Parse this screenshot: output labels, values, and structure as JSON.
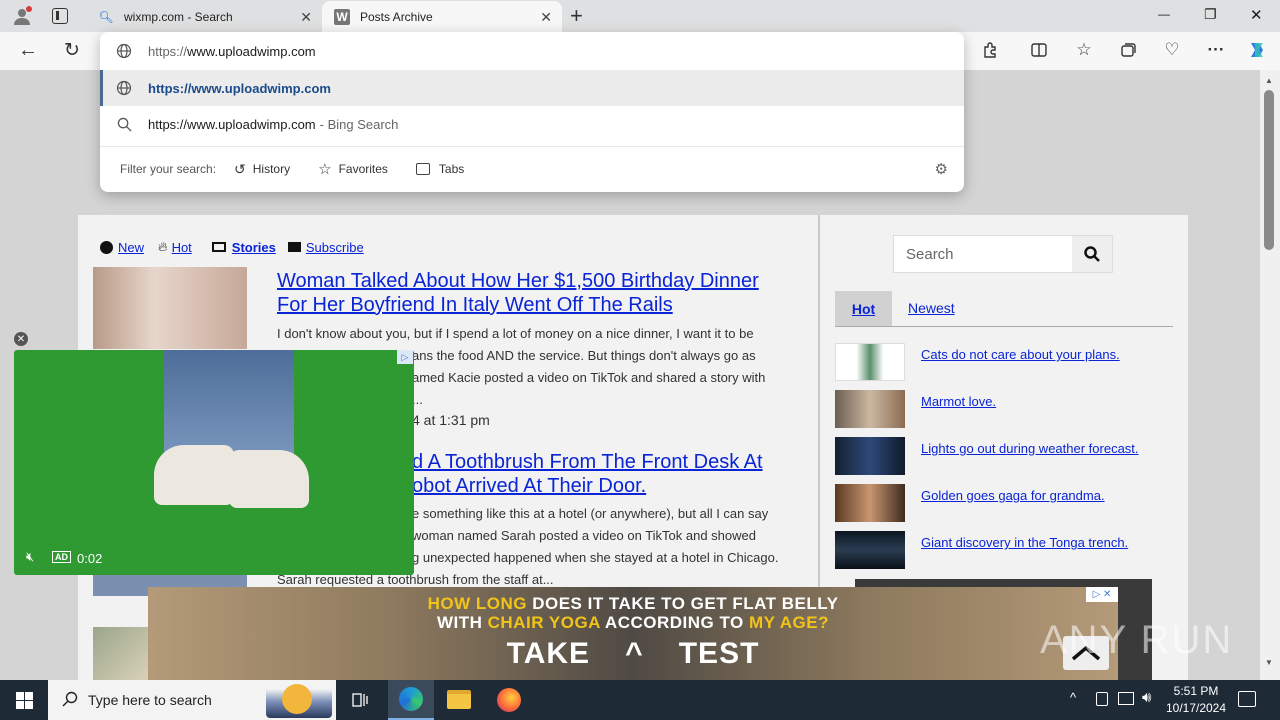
{
  "browser": {
    "tabs": [
      {
        "title": "wixmp.com - Search",
        "favicon": "search-icon",
        "active": false
      },
      {
        "title": "Posts Archive",
        "favicon": "W",
        "active": true
      }
    ],
    "new_tab": "+",
    "window_controls": {
      "minimize": "—",
      "maximize": "❐",
      "close": "✕"
    }
  },
  "omnibox": {
    "input_prefix": "https://",
    "input_value": "www.uploadwimp.com",
    "suggestions": [
      {
        "text": "https://www.uploadwimp.com",
        "icon": "globe-icon",
        "selected": true
      },
      {
        "text": "https://www.uploadwimp.com",
        "suffix": "- Bing Search",
        "icon": "search-icon",
        "selected": false
      }
    ],
    "filter_label": "Filter your search:",
    "filters": [
      "History",
      "Favorites",
      "Tabs"
    ]
  },
  "site": {
    "nav": [
      "New",
      "Hot",
      "Stories",
      "Subscribe"
    ],
    "posts": [
      {
        "title_line1": "Woman Talked About How Her $1,500 Birthday Dinner",
        "title_line2": "For Her Boyfriend In Italy Went Off The Rails",
        "excerpt": [
          "I don't know about you, but if I spend a lot of money on a nice dinner, I want it to be",
          "ans the food AND the service. But things don't always go as",
          "amed Kacie posted a video on TikTok and shared a story with",
          "..."
        ],
        "date": "4 at 1:31 pm"
      },
      {
        "title_line1": "d A Toothbrush From The Front Desk At",
        "title_line2": "obot Arrived At Their Door.",
        "excerpt": [
          "e something like this at a hotel (or anywhere), but all I can say",
          "woman named Sarah posted a video on TikTok and showed",
          "g unexpected happened when she stayed at a hotel in Chicago.",
          "Sarah requested a toothbrush from the staff at..."
        ]
      }
    ],
    "search_placeholder": "Search",
    "sidebar_tabs": [
      "Hot",
      "Newest"
    ],
    "hot_items": [
      "Cats do not care about your plans.",
      "Marmot love.",
      "Lights go out during weather forecast.",
      "Golden goes gaga for grandma.",
      "Giant discovery in the Tonga trench."
    ]
  },
  "video_ad": {
    "time": "0:02",
    "badge": "AD"
  },
  "banner_ad": {
    "line1_parts": [
      "HOW LONG",
      " DOES IT TAKE TO GET FLAT BELLY"
    ],
    "line2_parts": [
      "WITH ",
      "CHAIR YOGA",
      " ACCORDING TO ",
      "MY AGE?"
    ],
    "cta_left": "TAKE",
    "cta_right": "TEST"
  },
  "watermark": "ANY RUN",
  "taskbar": {
    "search_placeholder": "Type here to search",
    "time": "5:51 PM",
    "date": "10/17/2024"
  },
  "colors": {
    "link": "#0a24d6",
    "taskbar": "#1e2a36",
    "ad_yellow": "#f2c419"
  }
}
